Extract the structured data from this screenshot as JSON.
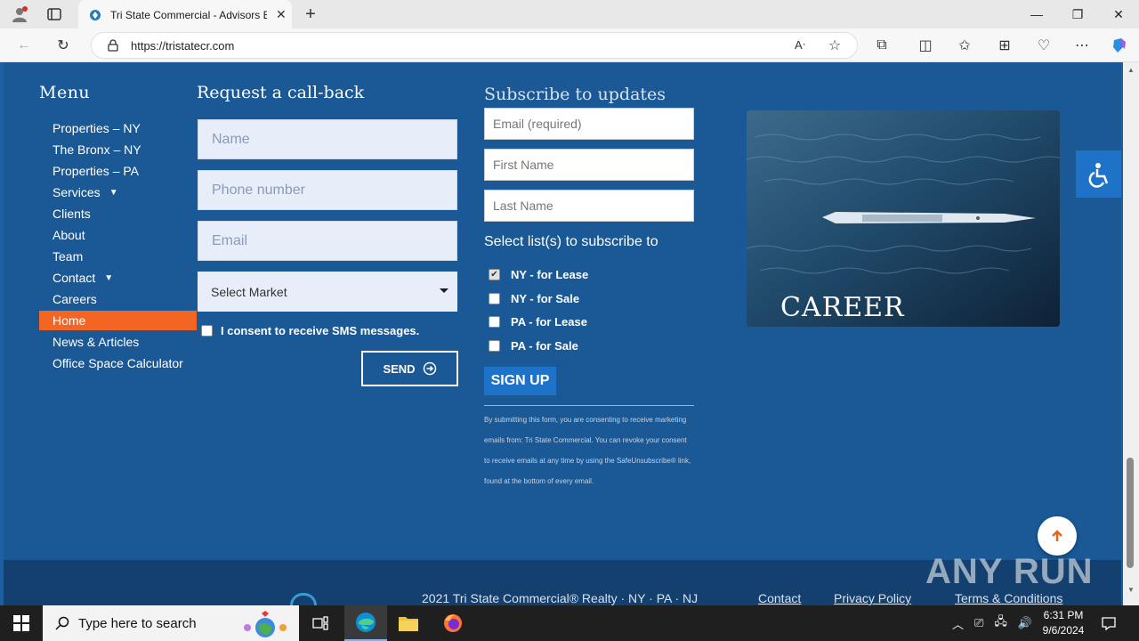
{
  "browser": {
    "tab_title": "Tri State Commercial - Advisors B",
    "url": "https://tristatecr.com"
  },
  "menu": {
    "title": "Menu",
    "items": [
      {
        "label": "Properties – NY",
        "has_sub": false
      },
      {
        "label": "The Bronx – NY",
        "has_sub": false
      },
      {
        "label": "Properties – PA",
        "has_sub": false
      },
      {
        "label": "Services",
        "has_sub": true
      },
      {
        "label": "Clients",
        "has_sub": false
      },
      {
        "label": "About",
        "has_sub": false
      },
      {
        "label": "Team",
        "has_sub": false
      },
      {
        "label": "Contact",
        "has_sub": true
      },
      {
        "label": "Careers",
        "has_sub": false
      },
      {
        "label": "Home",
        "has_sub": false,
        "active": true
      },
      {
        "label": "News & Articles",
        "has_sub": false
      },
      {
        "label": "Office Space Calculator",
        "has_sub": false
      }
    ]
  },
  "callback": {
    "title": "Request a call-back",
    "name_placeholder": "Name",
    "phone_placeholder": "Phone number",
    "email_placeholder": "Email",
    "market_selected": "Select Market",
    "sms_consent": "I consent to receive SMS messages.",
    "send_label": "SEND"
  },
  "subscribe": {
    "title": "Subscribe to updates",
    "email_placeholder": "Email (required)",
    "first_name_placeholder": "First Name",
    "last_name_placeholder": "Last Name",
    "lists_title": "Select list(s) to subscribe to",
    "lists": [
      {
        "label": "NY - for Lease",
        "checked": true
      },
      {
        "label": "NY - for Sale",
        "checked": false
      },
      {
        "label": "PA - for Lease",
        "checked": false
      },
      {
        "label": "PA - for Sale",
        "checked": false
      }
    ],
    "signup_label": "SIGN UP",
    "disclaimer": "By submitting this form, you are consenting to receive marketing emails from: Tri State Commercial. You can revoke your consent to receive emails at any time by using the SafeUnsubscribe® link, found at the bottom of every email."
  },
  "career": {
    "label": "CAREER"
  },
  "footer": {
    "copyright": "2021 Tri State Commercial® Realty · NY · PA · NJ",
    "contact": "Contact",
    "privacy": "Privacy Policy",
    "terms": "Terms & Conditions"
  },
  "watermark": "ANY RUN",
  "taskbar": {
    "search_placeholder": "Type here to search",
    "time": "6:31 PM",
    "date": "9/6/2024"
  },
  "colors": {
    "page_bg": "#1a5896",
    "active_menu": "#f26522",
    "button_blue": "#1e73c8"
  }
}
